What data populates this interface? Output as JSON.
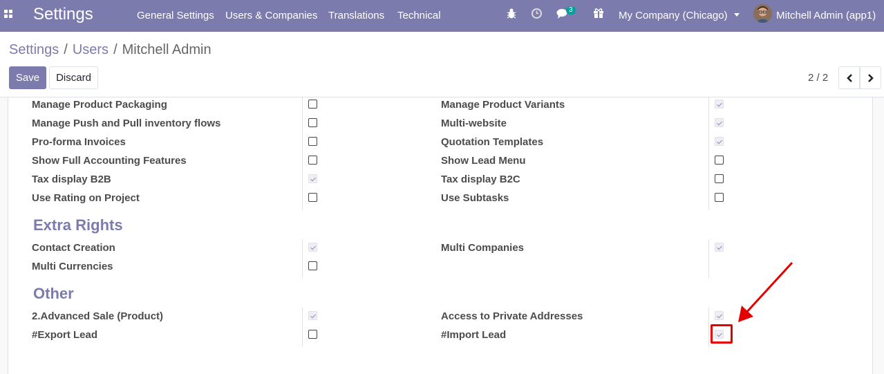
{
  "navbar": {
    "app_title": "Settings",
    "menus": [
      "General Settings",
      "Users & Companies",
      "Translations",
      "Technical"
    ],
    "icons": [
      "bug-icon",
      "clock-icon",
      "chat-icon",
      "gift-icon"
    ],
    "messages_count": "3",
    "company": "My Company (Chicago)",
    "user": "Mitchell Admin (app1)",
    "colors": {
      "brand": "#7c7bad",
      "badge": "#00a09d"
    }
  },
  "breadcrumb": {
    "root": "Settings",
    "parent": "Users",
    "current": "Mitchell Admin",
    "separator": "/"
  },
  "buttons": {
    "save": "Save",
    "discard": "Discard"
  },
  "pager": {
    "value": "2 / 2"
  },
  "groups": {
    "top": {
      "left": [
        {
          "label": "Manage Product Packaging",
          "checked": false
        },
        {
          "label": "Manage Push and Pull inventory flows",
          "checked": false
        },
        {
          "label": "Pro-forma Invoices",
          "checked": false
        },
        {
          "label": "Show Full Accounting Features",
          "checked": false
        },
        {
          "label": "Tax display B2B",
          "checked": true
        },
        {
          "label": "Use Rating on Project",
          "checked": false
        }
      ],
      "right": [
        {
          "label": "Manage Product Variants",
          "checked": true
        },
        {
          "label": "Multi-website",
          "checked": true
        },
        {
          "label": "Quotation Templates",
          "checked": true
        },
        {
          "label": "Show Lead Menu",
          "checked": false
        },
        {
          "label": "Tax display B2C",
          "checked": false
        },
        {
          "label": "Use Subtasks",
          "checked": false
        }
      ]
    },
    "extra_rights": {
      "title": "Extra Rights",
      "left": [
        {
          "label": "Contact Creation",
          "checked": true
        },
        {
          "label": "Multi Currencies",
          "checked": false
        }
      ],
      "right": [
        {
          "label": "Multi Companies",
          "checked": true
        }
      ]
    },
    "other": {
      "title": "Other",
      "left": [
        {
          "label": "2.Advanced Sale (Product)",
          "checked": true
        },
        {
          "label": "#Export Lead",
          "checked": false
        }
      ],
      "right": [
        {
          "label": "Access to Private Addresses",
          "checked": true
        },
        {
          "label": "#Import Lead",
          "checked": true
        }
      ]
    }
  },
  "annotation": {
    "color": "#e50000"
  }
}
